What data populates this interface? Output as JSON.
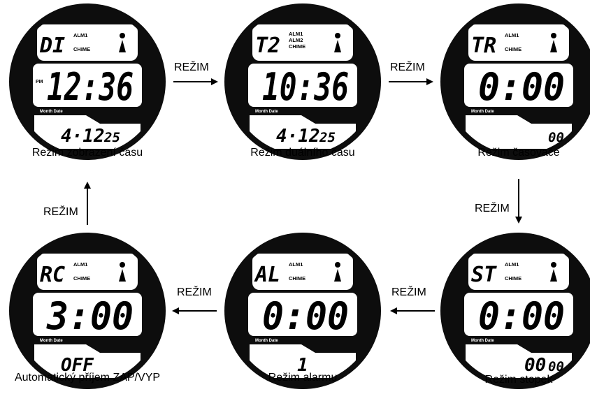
{
  "arrow_label": "REŽIM",
  "month_date_label": "Month Date",
  "modes": [
    {
      "id": "time",
      "code": "DI",
      "tags": [
        "ALM1",
        "CHIME"
      ],
      "pm": "PM",
      "main": "12:36",
      "bottom_main": "4·12",
      "bottom_small": "25",
      "caption": "Režim zobrazení času"
    },
    {
      "id": "dual",
      "code": "T2",
      "tags": [
        "ALM1",
        "ALM2",
        "CHIME"
      ],
      "pm": "",
      "main": "10:36",
      "bottom_main": "4·12",
      "bottom_small": "25",
      "caption": "Režim duálního času"
    },
    {
      "id": "timer",
      "code": "TR",
      "tags": [
        "ALM1",
        "CHIME"
      ],
      "pm": "",
      "main": "0:00",
      "bottom_main": "",
      "bottom_small": "00",
      "caption": "Režim časovače"
    },
    {
      "id": "stopwatch",
      "code": "ST",
      "tags": [
        "ALM1",
        "CHIME"
      ],
      "pm": "",
      "main": "0:00",
      "bottom_main": "00",
      "bottom_small": "00",
      "caption": "Režim stopek"
    },
    {
      "id": "alarm",
      "code": "AL",
      "tags": [
        "ALM1",
        "CHIME"
      ],
      "pm": "",
      "main": "0:00",
      "bottom_main": "1",
      "bottom_small": "",
      "caption": "Režim alarmu"
    },
    {
      "id": "radio",
      "code": "RC",
      "tags": [
        "ALM1",
        "CHIME"
      ],
      "pm": "",
      "main": "3:00",
      "bottom_main": "OFF",
      "bottom_small": "",
      "caption": "Automatický příjem ZAP/VYP"
    }
  ]
}
